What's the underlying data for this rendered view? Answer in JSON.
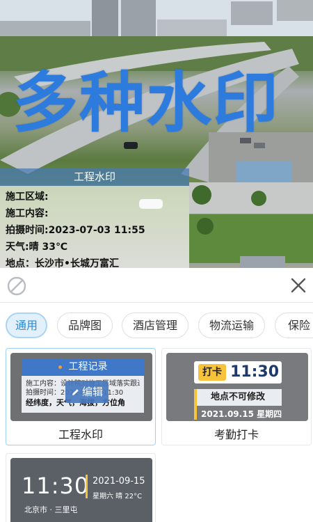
{
  "photo": {
    "headline": "多种水印",
    "watermark": {
      "title": "工程水印",
      "lines": [
        "施工区域:",
        "施工内容:",
        "拍摄时间:2023-07-03 11:55",
        "天气:晴 33℃",
        "地点：长沙市•长城万富汇"
      ]
    }
  },
  "panel": {
    "tabs": [
      {
        "label": "通用",
        "active": true
      },
      {
        "label": "品牌图",
        "active": false
      },
      {
        "label": "酒店管理",
        "active": false
      },
      {
        "label": "物流运输",
        "active": false
      },
      {
        "label": "保险",
        "active": false
      }
    ],
    "templates": [
      {
        "name": "工程水印",
        "thumb": {
          "header": "工程记录",
          "lines": [
            "施工内容：设计院对施工区域落实跟进",
            "拍摄时间：2021-09-15 11:30",
            "经纬度，天气，海拔，方位角"
          ],
          "edit_label": "编辑"
        }
      },
      {
        "name": "考勤打卡",
        "thumb": {
          "badge": "打卡",
          "time": "11:30",
          "location": "地点不可修改",
          "date": "2021.09.15  星期四"
        }
      },
      {
        "name": "",
        "thumb": {
          "time": "11:30",
          "date": "2021-09-15",
          "week": "星期六  晴  22°C",
          "location": "北京市 · 三里屯"
        }
      }
    ]
  },
  "colors": {
    "accent": "#2a8ad4",
    "headline": "#2d7bdc",
    "watermark_header": "#4678b4",
    "badge_yellow": "#f7c33a"
  }
}
